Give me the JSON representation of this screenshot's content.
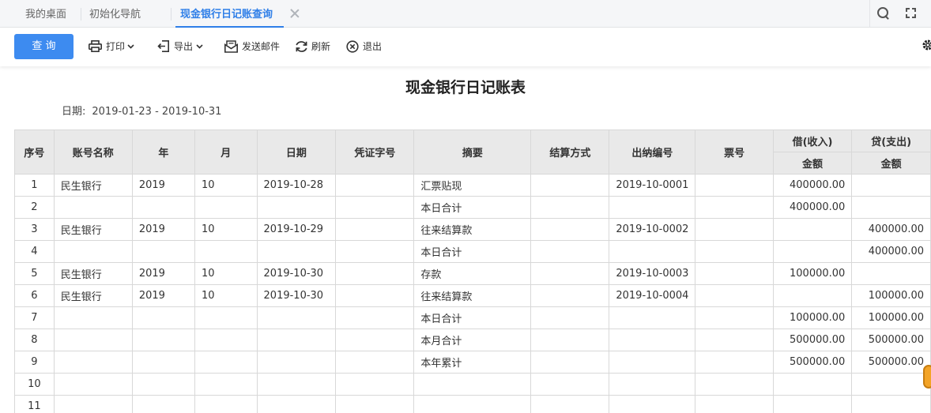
{
  "tabs": [
    {
      "label": "我的桌面",
      "active": false
    },
    {
      "label": "初始化导航",
      "active": false
    },
    {
      "label": "现金银行日记账查询",
      "active": true
    }
  ],
  "toolbar": {
    "query_label": "查 询",
    "print_label": "打印",
    "export_label": "导出",
    "email_label": "发送邮件",
    "refresh_label": "刷新",
    "exit_label": "退出",
    "accent_color": "#3d8bf0"
  },
  "report": {
    "title": "现金银行日记账表",
    "date_label": "日期:",
    "date_range": "2019-01-23 - 2019-10-31"
  },
  "table": {
    "headers": {
      "seq": "序号",
      "account": "账号名称",
      "year": "年",
      "month": "月",
      "date": "日期",
      "voucher": "凭证字号",
      "summary": "摘要",
      "settle": "结算方式",
      "cashier_no": "出纳编号",
      "ticket": "票号",
      "debit": "借(收入)",
      "credit": "贷(支出)",
      "amount": "金额"
    },
    "rows": [
      [
        "1",
        "民生银行",
        "2019",
        "10",
        "2019-10-28",
        "",
        "汇票贴现",
        "",
        "2019-10-0001",
        "",
        "400000.00",
        ""
      ],
      [
        "2",
        "",
        "",
        "",
        "",
        "",
        "本日合计",
        "",
        "",
        "",
        "400000.00",
        ""
      ],
      [
        "3",
        "民生银行",
        "2019",
        "10",
        "2019-10-29",
        "",
        "往来结算款",
        "",
        "2019-10-0002",
        "",
        "",
        "400000.00"
      ],
      [
        "4",
        "",
        "",
        "",
        "",
        "",
        "本日合计",
        "",
        "",
        "",
        "",
        "400000.00"
      ],
      [
        "5",
        "民生银行",
        "2019",
        "10",
        "2019-10-30",
        "",
        "存款",
        "",
        "2019-10-0003",
        "",
        "100000.00",
        ""
      ],
      [
        "6",
        "民生银行",
        "2019",
        "10",
        "2019-10-30",
        "",
        "往来结算款",
        "",
        "2019-10-0004",
        "",
        "",
        "100000.00"
      ],
      [
        "7",
        "",
        "",
        "",
        "",
        "",
        "本日合计",
        "",
        "",
        "",
        "100000.00",
        "100000.00"
      ],
      [
        "8",
        "",
        "",
        "",
        "",
        "",
        "本月合计",
        "",
        "",
        "",
        "500000.00",
        "500000.00"
      ],
      [
        "9",
        "",
        "",
        "",
        "",
        "",
        "本年累计",
        "",
        "",
        "",
        "500000.00",
        "500000.00"
      ],
      [
        "10",
        "",
        "",
        "",
        "",
        "",
        "",
        "",
        "",
        "",
        "",
        ""
      ],
      [
        "11",
        "",
        "",
        "",
        "",
        "",
        "",
        "",
        "",
        "",
        "",
        ""
      ]
    ]
  }
}
